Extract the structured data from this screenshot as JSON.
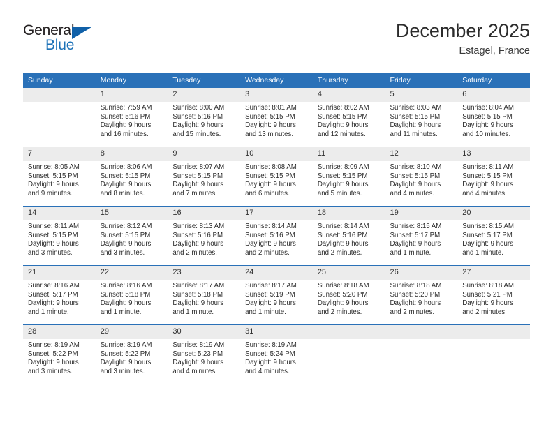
{
  "brand": {
    "name_primary": "General",
    "name_secondary": "Blue",
    "triangle_color": "#1060a8"
  },
  "header": {
    "title": "December 2025",
    "location": "Estagel, France"
  },
  "theme": {
    "header_blue": "#2a71b8",
    "daynum_band": "#ececec",
    "text": "#2c2c2c"
  },
  "weekdays": [
    "Sunday",
    "Monday",
    "Tuesday",
    "Wednesday",
    "Thursday",
    "Friday",
    "Saturday"
  ],
  "labels": {
    "sunrise_prefix": "Sunrise:",
    "sunset_prefix": "Sunset:",
    "daylight_prefix": "Daylight:"
  },
  "weeks": [
    [
      {
        "day": "",
        "lines": []
      },
      {
        "day": "1",
        "lines": [
          "Sunrise: 7:59 AM",
          "Sunset: 5:16 PM",
          "Daylight: 9 hours and 16 minutes."
        ]
      },
      {
        "day": "2",
        "lines": [
          "Sunrise: 8:00 AM",
          "Sunset: 5:16 PM",
          "Daylight: 9 hours and 15 minutes."
        ]
      },
      {
        "day": "3",
        "lines": [
          "Sunrise: 8:01 AM",
          "Sunset: 5:15 PM",
          "Daylight: 9 hours and 13 minutes."
        ]
      },
      {
        "day": "4",
        "lines": [
          "Sunrise: 8:02 AM",
          "Sunset: 5:15 PM",
          "Daylight: 9 hours and 12 minutes."
        ]
      },
      {
        "day": "5",
        "lines": [
          "Sunrise: 8:03 AM",
          "Sunset: 5:15 PM",
          "Daylight: 9 hours and 11 minutes."
        ]
      },
      {
        "day": "6",
        "lines": [
          "Sunrise: 8:04 AM",
          "Sunset: 5:15 PM",
          "Daylight: 9 hours and 10 minutes."
        ]
      }
    ],
    [
      {
        "day": "7",
        "lines": [
          "Sunrise: 8:05 AM",
          "Sunset: 5:15 PM",
          "Daylight: 9 hours and 9 minutes."
        ]
      },
      {
        "day": "8",
        "lines": [
          "Sunrise: 8:06 AM",
          "Sunset: 5:15 PM",
          "Daylight: 9 hours and 8 minutes."
        ]
      },
      {
        "day": "9",
        "lines": [
          "Sunrise: 8:07 AM",
          "Sunset: 5:15 PM",
          "Daylight: 9 hours and 7 minutes."
        ]
      },
      {
        "day": "10",
        "lines": [
          "Sunrise: 8:08 AM",
          "Sunset: 5:15 PM",
          "Daylight: 9 hours and 6 minutes."
        ]
      },
      {
        "day": "11",
        "lines": [
          "Sunrise: 8:09 AM",
          "Sunset: 5:15 PM",
          "Daylight: 9 hours and 5 minutes."
        ]
      },
      {
        "day": "12",
        "lines": [
          "Sunrise: 8:10 AM",
          "Sunset: 5:15 PM",
          "Daylight: 9 hours and 4 minutes."
        ]
      },
      {
        "day": "13",
        "lines": [
          "Sunrise: 8:11 AM",
          "Sunset: 5:15 PM",
          "Daylight: 9 hours and 4 minutes."
        ]
      }
    ],
    [
      {
        "day": "14",
        "lines": [
          "Sunrise: 8:11 AM",
          "Sunset: 5:15 PM",
          "Daylight: 9 hours and 3 minutes."
        ]
      },
      {
        "day": "15",
        "lines": [
          "Sunrise: 8:12 AM",
          "Sunset: 5:15 PM",
          "Daylight: 9 hours and 3 minutes."
        ]
      },
      {
        "day": "16",
        "lines": [
          "Sunrise: 8:13 AM",
          "Sunset: 5:16 PM",
          "Daylight: 9 hours and 2 minutes."
        ]
      },
      {
        "day": "17",
        "lines": [
          "Sunrise: 8:14 AM",
          "Sunset: 5:16 PM",
          "Daylight: 9 hours and 2 minutes."
        ]
      },
      {
        "day": "18",
        "lines": [
          "Sunrise: 8:14 AM",
          "Sunset: 5:16 PM",
          "Daylight: 9 hours and 2 minutes."
        ]
      },
      {
        "day": "19",
        "lines": [
          "Sunrise: 8:15 AM",
          "Sunset: 5:17 PM",
          "Daylight: 9 hours and 1 minute."
        ]
      },
      {
        "day": "20",
        "lines": [
          "Sunrise: 8:15 AM",
          "Sunset: 5:17 PM",
          "Daylight: 9 hours and 1 minute."
        ]
      }
    ],
    [
      {
        "day": "21",
        "lines": [
          "Sunrise: 8:16 AM",
          "Sunset: 5:17 PM",
          "Daylight: 9 hours and 1 minute."
        ]
      },
      {
        "day": "22",
        "lines": [
          "Sunrise: 8:16 AM",
          "Sunset: 5:18 PM",
          "Daylight: 9 hours and 1 minute."
        ]
      },
      {
        "day": "23",
        "lines": [
          "Sunrise: 8:17 AM",
          "Sunset: 5:18 PM",
          "Daylight: 9 hours and 1 minute."
        ]
      },
      {
        "day": "24",
        "lines": [
          "Sunrise: 8:17 AM",
          "Sunset: 5:19 PM",
          "Daylight: 9 hours and 1 minute."
        ]
      },
      {
        "day": "25",
        "lines": [
          "Sunrise: 8:18 AM",
          "Sunset: 5:20 PM",
          "Daylight: 9 hours and 2 minutes."
        ]
      },
      {
        "day": "26",
        "lines": [
          "Sunrise: 8:18 AM",
          "Sunset: 5:20 PM",
          "Daylight: 9 hours and 2 minutes."
        ]
      },
      {
        "day": "27",
        "lines": [
          "Sunrise: 8:18 AM",
          "Sunset: 5:21 PM",
          "Daylight: 9 hours and 2 minutes."
        ]
      }
    ],
    [
      {
        "day": "28",
        "lines": [
          "Sunrise: 8:19 AM",
          "Sunset: 5:22 PM",
          "Daylight: 9 hours and 3 minutes."
        ]
      },
      {
        "day": "29",
        "lines": [
          "Sunrise: 8:19 AM",
          "Sunset: 5:22 PM",
          "Daylight: 9 hours and 3 minutes."
        ]
      },
      {
        "day": "30",
        "lines": [
          "Sunrise: 8:19 AM",
          "Sunset: 5:23 PM",
          "Daylight: 9 hours and 4 minutes."
        ]
      },
      {
        "day": "31",
        "lines": [
          "Sunrise: 8:19 AM",
          "Sunset: 5:24 PM",
          "Daylight: 9 hours and 4 minutes."
        ]
      },
      {
        "day": "",
        "lines": []
      },
      {
        "day": "",
        "lines": []
      },
      {
        "day": "",
        "lines": []
      }
    ]
  ]
}
